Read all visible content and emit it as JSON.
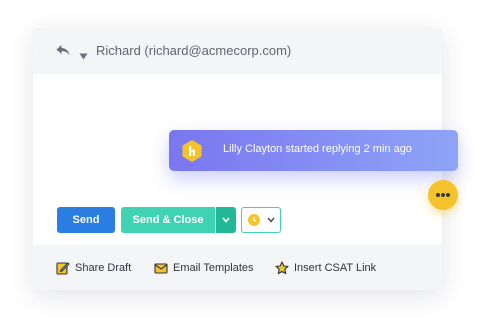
{
  "header": {
    "recipient": "Richard (richard@acmecorp.com)",
    "reply_icon": "reply-arrow-icon",
    "caret_icon": "caret-down-icon"
  },
  "notification": {
    "text": "Lilly Clayton started replying 2 min ago",
    "logo_icon": "hexagon-logo-icon",
    "gradient_start": "#7a76f0",
    "gradient_end": "#8ea4f7"
  },
  "typing_indicator": {
    "icon": "typing-dots-icon",
    "color": "#f5c42c"
  },
  "buttons": {
    "send": "Send",
    "send_close": "Send & Close",
    "send_color": "#2a7de1",
    "send_close_color": "#3fd2b3"
  },
  "footer": {
    "share_draft": "Share Draft",
    "email_templates": "Email Templates",
    "insert_csat": "Insert CSAT Link"
  }
}
